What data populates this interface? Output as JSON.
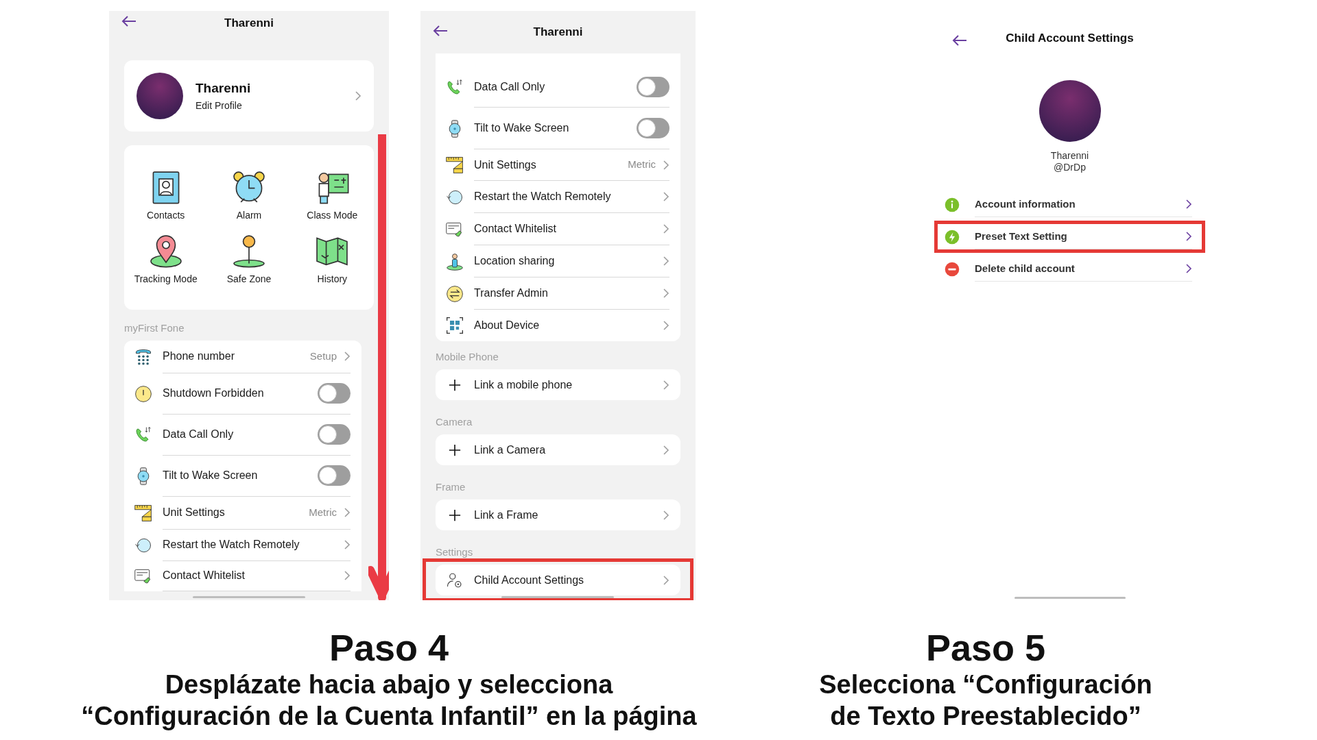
{
  "screen_1": {
    "title": "Tharenni",
    "profile": {
      "name": "Tharenni",
      "subtitle": "Edit Profile"
    },
    "features": [
      "Contacts",
      "Alarm",
      "Class Mode",
      "Tracking Mode",
      "Safe Zone",
      "History"
    ],
    "section": "myFirst Fone",
    "rows": [
      {
        "kind": "value",
        "label": "Phone number",
        "value": "Setup"
      },
      {
        "kind": "toggle",
        "label": "Shutdown Forbidden",
        "on": false
      },
      {
        "kind": "toggle",
        "label": "Data Call Only",
        "on": false
      },
      {
        "kind": "toggle",
        "label": "Tilt to Wake Screen",
        "on": false
      },
      {
        "kind": "value",
        "label": "Unit Settings",
        "value": "Metric"
      },
      {
        "kind": "link",
        "label": "Restart the Watch Remotely"
      },
      {
        "kind": "link",
        "label": "Contact Whitelist"
      }
    ]
  },
  "screen_2": {
    "title": "Tharenni",
    "rows": [
      {
        "kind": "toggle",
        "label": "Data Call Only",
        "on": false
      },
      {
        "kind": "toggle",
        "label": "Tilt to Wake Screen",
        "on": false
      },
      {
        "kind": "value",
        "label": "Unit Settings",
        "value": "Metric"
      },
      {
        "kind": "link",
        "label": "Restart the Watch Remotely"
      },
      {
        "kind": "link",
        "label": "Contact Whitelist"
      },
      {
        "kind": "link",
        "label": "Location sharing"
      },
      {
        "kind": "link",
        "label": "Transfer Admin"
      },
      {
        "kind": "link",
        "label": "About Device"
      }
    ],
    "groups": [
      {
        "heading": "Mobile Phone",
        "label": "Link a mobile phone",
        "highlighted": false
      },
      {
        "heading": "Camera",
        "label": "Link a Camera",
        "highlighted": false
      },
      {
        "heading": "Frame",
        "label": "Link a Frame",
        "highlighted": false
      },
      {
        "heading": "Settings",
        "label": "Child Account Settings",
        "highlighted": true
      }
    ]
  },
  "screen_3": {
    "title": "Child Account Settings",
    "name": "Tharenni",
    "handle": "@DrDp",
    "rows": [
      {
        "label": "Account information",
        "highlighted": false
      },
      {
        "label": "Preset Text Setting",
        "highlighted": true
      },
      {
        "label": "Delete child account",
        "highlighted": false
      }
    ]
  },
  "captions": [
    {
      "title": "Paso 4",
      "text": "Desplázate hacia abajo y selecciona\n“Configuración de la Cuenta Infantil” en la página"
    },
    {
      "title": "Paso 5",
      "text": "Selecciona “Configuración\nde Texto Preestablecido”"
    }
  ]
}
